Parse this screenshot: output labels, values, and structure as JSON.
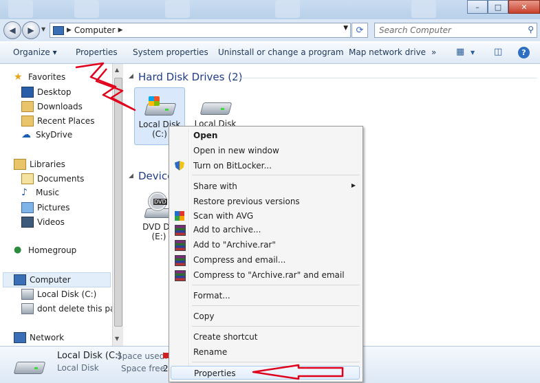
{
  "window": {
    "title_controls": {
      "minimize": "–",
      "maximize": "□",
      "close": "✕"
    }
  },
  "address_bar": {
    "breadcrumb_root": "Computer",
    "search_placeholder": "Search Computer"
  },
  "command_bar": {
    "items": [
      "Organize ▾",
      "Properties",
      "System properties",
      "Uninstall or change a program",
      "Map network drive",
      "»"
    ]
  },
  "nav_pane": {
    "favorites": {
      "label": "Favorites",
      "items": [
        "Desktop",
        "Downloads",
        "Recent Places",
        "SkyDrive"
      ]
    },
    "libraries": {
      "label": "Libraries",
      "items": [
        "Documents",
        "Music",
        "Pictures",
        "Videos"
      ]
    },
    "homegroup": "Homegroup",
    "computer": {
      "label": "Computer",
      "items": [
        "Local Disk (C:)",
        "dont delete this parti"
      ]
    },
    "network": "Network"
  },
  "content": {
    "hard_disk_group": "Hard Disk Drives (2)",
    "devices_group": "Device",
    "drives": {
      "c_line1": "Local Disk",
      "c_line2": "(C:)",
      "second_drive_line1": "Local Disk"
    },
    "dvd": {
      "line1": "DVD Dri",
      "line2": "(E:)",
      "disc_label": "DVD"
    }
  },
  "details": {
    "name": "Local Disk (C:)",
    "type": "Local Disk",
    "space_used_label": "Space used:",
    "space_free_label": "Space free:",
    "space_free_value": "2."
  },
  "context_menu": {
    "open": "Open",
    "open_new_window": "Open in new window",
    "bitlocker": "Turn on BitLocker...",
    "share_with": "Share with",
    "restore": "Restore previous versions",
    "scan_avg": "Scan with AVG",
    "add_archive": "Add to archive...",
    "add_rar": "Add to \"Archive.rar\"",
    "compress_email": "Compress and email...",
    "compress_rar_email": "Compress to \"Archive.rar\" and email",
    "format": "Format...",
    "copy": "Copy",
    "create_shortcut": "Create shortcut",
    "rename": "Rename",
    "properties": "Properties"
  },
  "colors": {
    "annotation_red": "#e0001b",
    "group_title": "#1f3c88",
    "selection": "#d9e8fb"
  }
}
